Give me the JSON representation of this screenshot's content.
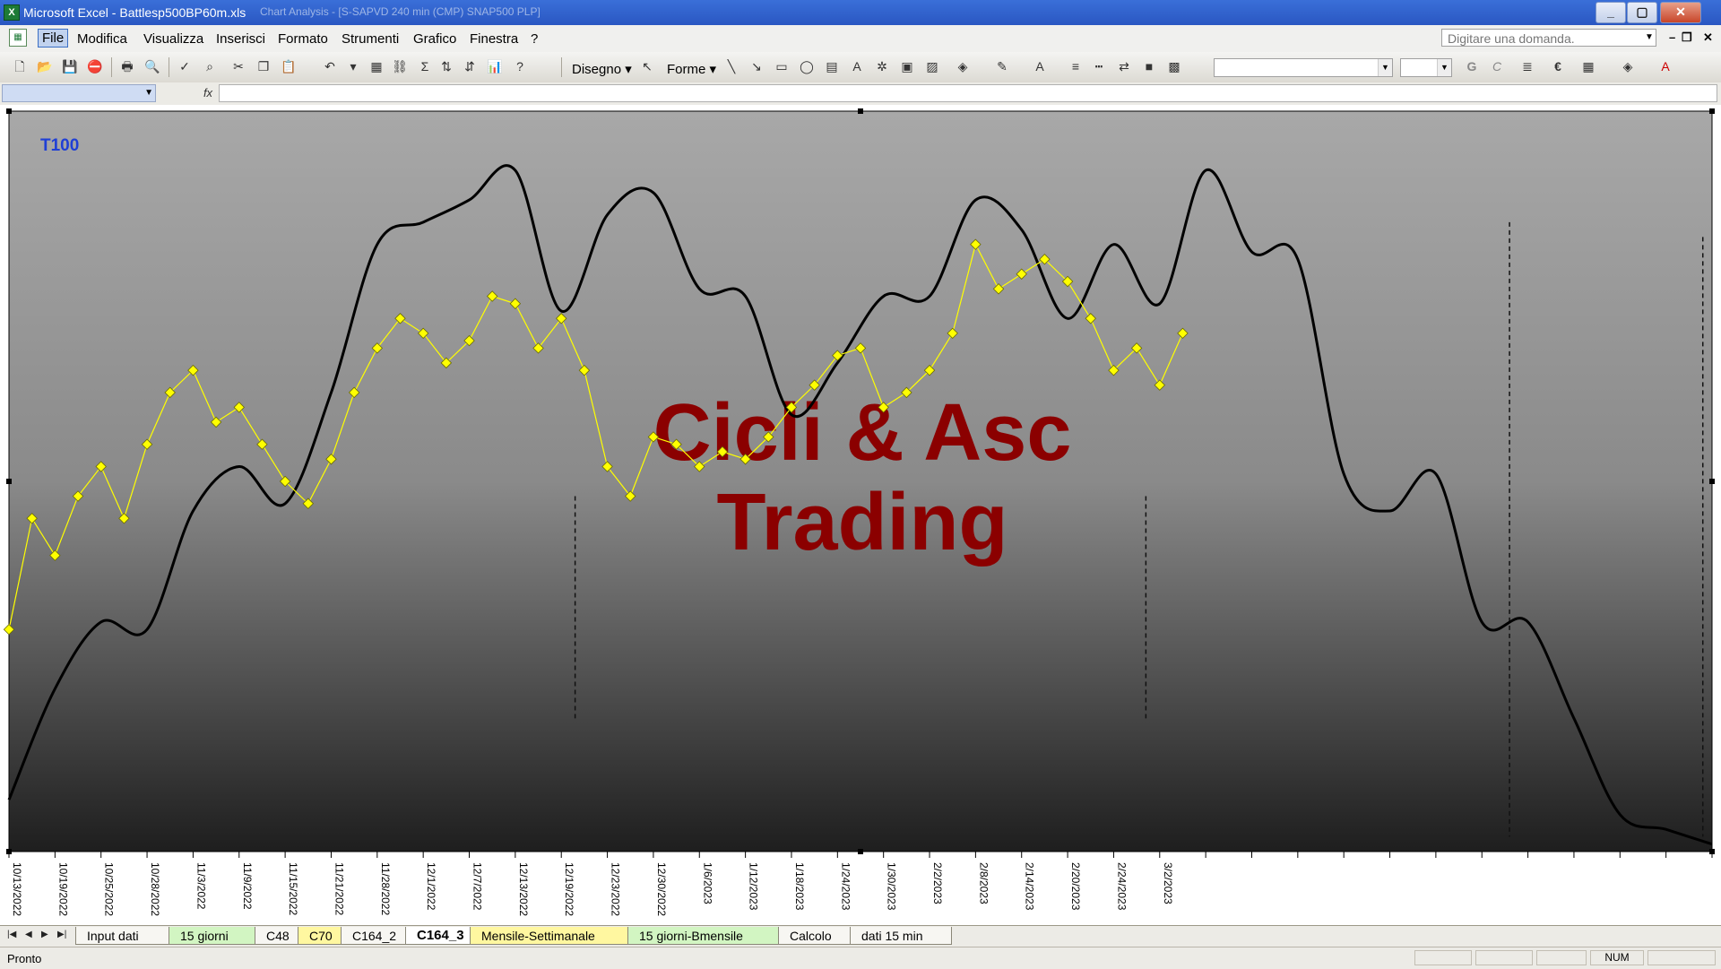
{
  "window": {
    "app_title": "Microsoft Excel - Battlesp500BP60m.xls",
    "ghost_title": "Chart Analysis - [S-SAPVD 240 min (CMP) SNAP500 PLP]"
  },
  "menu": {
    "items": [
      "File",
      "Modifica",
      "Visualizza",
      "Inserisci",
      "Formato",
      "Strumenti",
      "Grafico",
      "Finestra",
      "?"
    ],
    "help_placeholder": "Digitare una domanda."
  },
  "toolbar": {
    "draw_label": "Disegno",
    "shapes_label": "Forme",
    "bold_label": "G",
    "italic_label": "C",
    "euro_label": "€"
  },
  "chart_data": {
    "type": "line",
    "label": "T100",
    "watermark": [
      "Cicli & Asc",
      "Trading"
    ],
    "x_tick_labels": [
      "10/13/2022",
      "10/19/2022",
      "10/25/2022",
      "10/28/2022",
      "11/3/2022",
      "11/9/2022",
      "11/15/2022",
      "11/21/2022",
      "11/28/2022",
      "12/1/2022",
      "12/7/2022",
      "12/13/2022",
      "12/19/2022",
      "12/23/2022",
      "12/30/2022",
      "1/6/2023",
      "1/12/2023",
      "1/18/2023",
      "1/24/2023",
      "1/30/2023",
      "2/2/2023",
      "2/8/2023",
      "2/14/2023",
      "2/20/2023",
      "2/24/2023",
      "3/2/2023"
    ],
    "total_ticks": 37,
    "ylim": [
      0,
      100
    ],
    "series": [
      {
        "kind": "price-markers",
        "color": "#ffff00",
        "x": [
          0,
          0.5,
          1,
          1.5,
          2,
          2.5,
          3,
          3.5,
          4,
          4.5,
          5,
          5.5,
          6,
          6.5,
          7,
          7.5,
          8,
          8.5,
          9,
          9.5,
          10,
          10.5,
          11,
          11.5,
          12,
          12.5,
          13,
          13.5,
          14,
          14.5,
          15,
          15.5,
          16,
          16.5,
          17,
          17.5,
          18,
          18.5,
          19,
          19.5,
          20,
          20.5,
          21,
          21.5,
          22,
          22.5,
          23,
          23.5,
          24,
          24.5,
          25,
          25.5
        ],
        "values": [
          30,
          45,
          40,
          48,
          52,
          45,
          55,
          62,
          65,
          58,
          60,
          55,
          50,
          47,
          53,
          62,
          68,
          72,
          70,
          66,
          69,
          75,
          74,
          68,
          72,
          65,
          52,
          48,
          56,
          55,
          52,
          54,
          53,
          56,
          60,
          63,
          67,
          68,
          60,
          62,
          65,
          70,
          82,
          76,
          78,
          80,
          77,
          72,
          65,
          68,
          63,
          70
        ]
      },
      {
        "kind": "cycle-line",
        "color": "#000000",
        "x": [
          0,
          1,
          2,
          3,
          4,
          5,
          6,
          7,
          8,
          9,
          10,
          11,
          12,
          13,
          14,
          15,
          16,
          17,
          18,
          19,
          20,
          21,
          22,
          23,
          24,
          25,
          26,
          27,
          28,
          29,
          30,
          31,
          32,
          33,
          34,
          35,
          36,
          37
        ],
        "values": [
          7,
          22,
          31,
          30,
          46,
          52,
          47,
          62,
          82,
          85,
          88,
          92,
          73,
          86,
          89,
          76,
          75,
          59,
          66,
          75,
          75,
          88,
          84,
          72,
          82,
          74,
          92,
          81,
          80,
          51,
          46,
          51,
          31,
          31,
          18,
          5,
          3,
          1
        ]
      }
    ],
    "vertical_markers": [
      {
        "x": 12.3,
        "from": 18,
        "to": 48
      },
      {
        "x": 24.7,
        "from": 18,
        "to": 48
      },
      {
        "x": 32.6,
        "from": 2,
        "to": 85
      },
      {
        "x": 36.8,
        "from": 2,
        "to": 83
      }
    ]
  },
  "sheet_tabs": [
    {
      "label": "Input dati",
      "style": "normal"
    },
    {
      "label": "15 giorni",
      "style": "green"
    },
    {
      "label": "C48",
      "style": "normal"
    },
    {
      "label": "C70",
      "style": "yellow"
    },
    {
      "label": "C164_2",
      "style": "normal"
    },
    {
      "label": "C164_3",
      "style": "active"
    },
    {
      "label": "Mensile-Settimanale",
      "style": "yellow"
    },
    {
      "label": "15 giorni-Bmensile",
      "style": "green"
    },
    {
      "label": "Calcolo",
      "style": "normal"
    },
    {
      "label": "dati 15 min",
      "style": "normal"
    }
  ],
  "status": {
    "text": "Pronto",
    "num_indicator": "NUM"
  }
}
